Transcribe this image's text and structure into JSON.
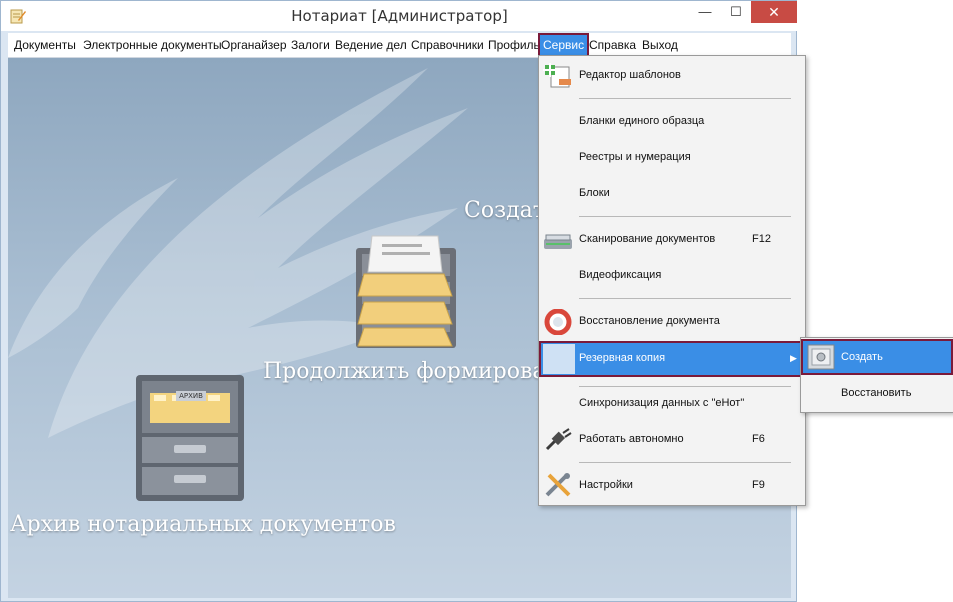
{
  "window": {
    "title": "Нотариат [Администратор]",
    "minimize": "—",
    "maximize": "☐",
    "close": "✕"
  },
  "menu": [
    {
      "label": "Документы"
    },
    {
      "label": "Электронные документы"
    },
    {
      "label": "Органайзер"
    },
    {
      "label": "Залоги"
    },
    {
      "label": "Ведение дел"
    },
    {
      "label": "Справочники"
    },
    {
      "label": "Профиль"
    },
    {
      "label": "Сервис",
      "active": true
    },
    {
      "label": "Справка"
    },
    {
      "label": "Выход"
    }
  ],
  "desktop": {
    "create_label": "Создат",
    "continue_label": "Продолжить формирован",
    "archive_label": "Архив нотариальных документов",
    "cabinet_tag": "АРХИВ"
  },
  "service_menu": {
    "items": [
      {
        "label": "Редактор шаблонов",
        "icon": "template-editor-icon"
      },
      {
        "label": "Бланки единого образца"
      },
      {
        "label": "Реестры и нумерация"
      },
      {
        "label": "Блоки"
      },
      {
        "label": "Сканирование документов",
        "shortcut": "F12",
        "icon": "scanner-icon"
      },
      {
        "label": "Видеофиксация"
      },
      {
        "label": "Восстановление документа",
        "icon": "lifebuoy-icon"
      },
      {
        "label": "Резервная копия",
        "highlighted": true
      },
      {
        "label": "Синхронизация данных с \"еНот\""
      },
      {
        "label": "Работать автономно",
        "shortcut": "F6",
        "icon": "plug-icon"
      },
      {
        "label": "Настройки",
        "shortcut": "F9",
        "icon": "tools-icon"
      }
    ]
  },
  "backup_submenu": {
    "items": [
      {
        "label": "Создать",
        "highlighted": true,
        "icon": "safe-icon"
      },
      {
        "label": "Восстановить"
      }
    ]
  },
  "colors": {
    "highlight": "#3a8ee6",
    "highlight_border": "#7a1a3a",
    "close_button": "#c84b44"
  }
}
